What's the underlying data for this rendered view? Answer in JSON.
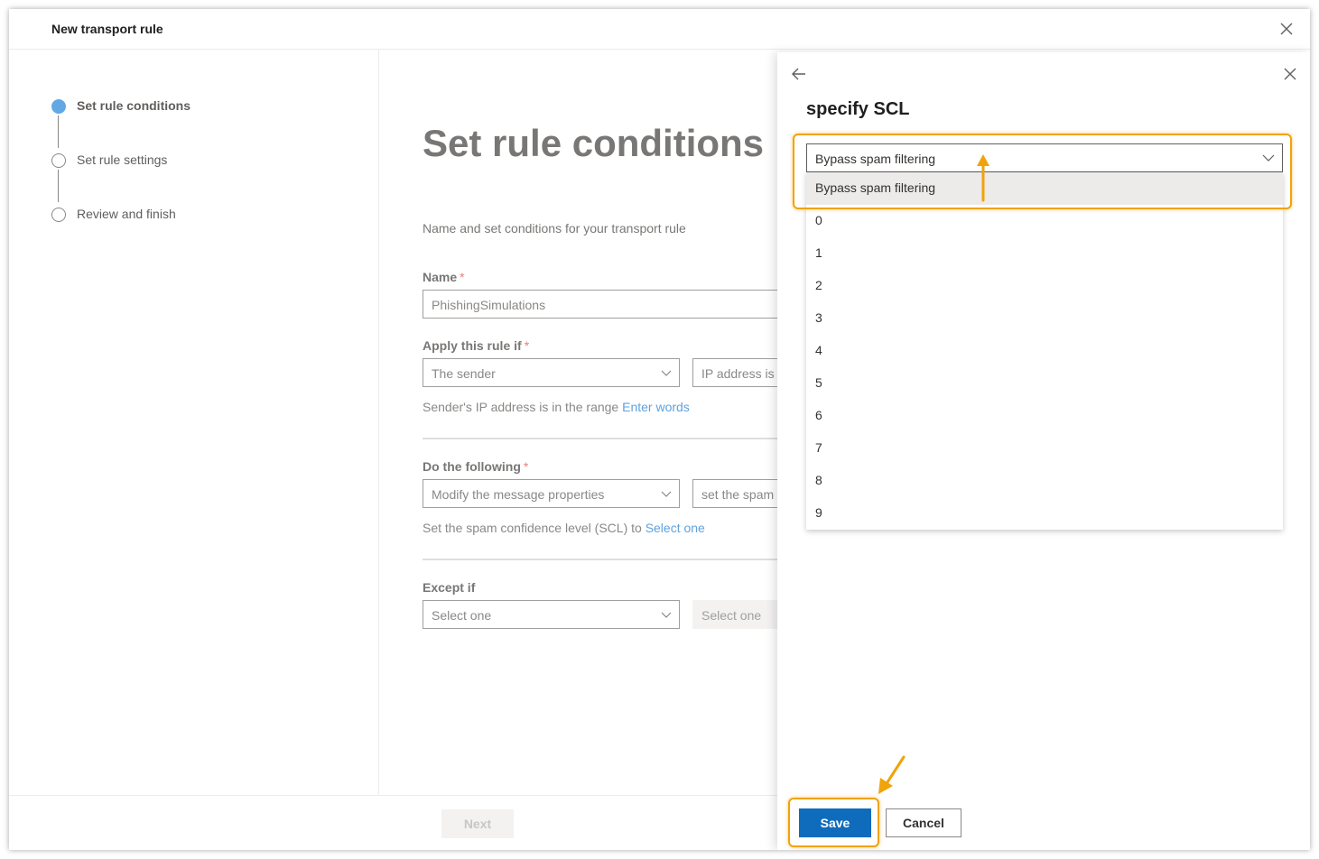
{
  "window": {
    "title": "New transport rule"
  },
  "steps": [
    {
      "label": "Set rule conditions",
      "active": true
    },
    {
      "label": "Set rule settings",
      "active": false
    },
    {
      "label": "Review and finish",
      "active": false
    }
  ],
  "main": {
    "title": "Set rule conditions",
    "subtitle": "Name and set conditions for your transport rule",
    "name": {
      "label": "Name",
      "required": "*",
      "value": "PhishingSimulations"
    },
    "apply": {
      "label": "Apply this rule if",
      "required": "*",
      "select1": "The sender",
      "select2": "IP address is in",
      "helper": "Sender's IP address is in the range",
      "link": "Enter words"
    },
    "do": {
      "label": "Do the following",
      "required": "*",
      "select1": "Modify the message properties",
      "select2": "set the spam confidence",
      "helper": "Set the spam confidence level (SCL) to",
      "link": "Select one"
    },
    "except": {
      "label": "Except if",
      "select1": "Select one",
      "select2": "Select one"
    },
    "next_label": "Next"
  },
  "panel": {
    "title": "specify SCL",
    "selected_value": "Bypass spam filtering",
    "options": [
      "Bypass spam filtering",
      "0",
      "1",
      "2",
      "3",
      "4",
      "5",
      "6",
      "7",
      "8",
      "9"
    ],
    "save_label": "Save",
    "cancel_label": "Cancel"
  },
  "colors": {
    "accent": "#0f6cbd",
    "highlight": "#f0a30a",
    "active_step": "#62a8e5",
    "link": "#5ea2de"
  }
}
